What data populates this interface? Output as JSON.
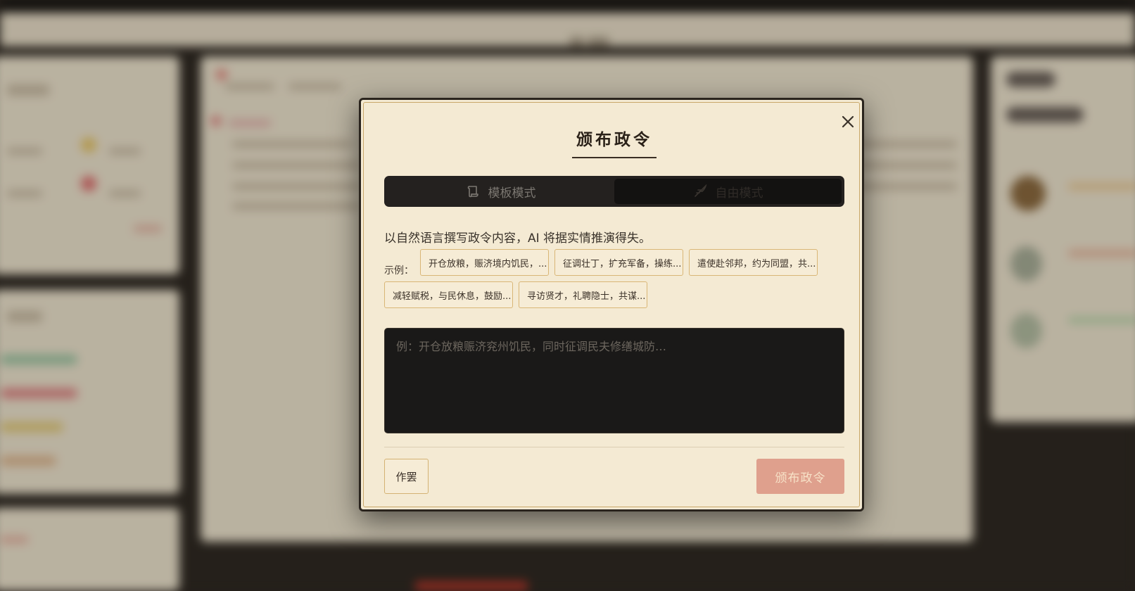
{
  "modal": {
    "title": "颁布政令",
    "close_icon": "close-icon",
    "modes": {
      "template_label": "模板模式",
      "template_icon": "scroll-icon",
      "free_label": "自由模式",
      "free_icon": "quill-icon",
      "active": "free"
    },
    "description": "以自然语言撰写政令内容，AI 将据实情推演得失。",
    "examples_label": "示例：",
    "examples": [
      "开仓放粮，赈济境内饥民，...",
      "征调壮丁，扩充军备，操练...",
      "遣使赴邻邦，约为同盟，共...",
      "减轻赋税，与民休息，鼓励...",
      "寻访贤才，礼聘隐士，共谋..."
    ],
    "input_value": "",
    "input_placeholder": "例：开仓放粮赈济兖州饥民，同时征调民夫修缮城防…",
    "cancel_label": "作罢",
    "submit_label": "颁布政令"
  },
  "colors": {
    "modal_bg": "#f4ead3",
    "chip_border": "#d9b676",
    "submit_bg": "#dfa08d",
    "input_bg": "#1a1918"
  }
}
